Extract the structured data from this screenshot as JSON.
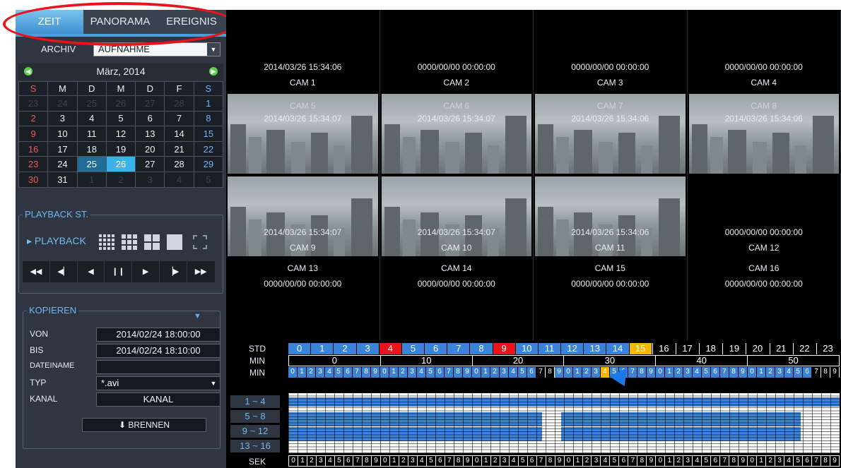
{
  "tabs": [
    {
      "label": "ZEIT",
      "active": true
    },
    {
      "label": "PANORAMA",
      "active": false
    },
    {
      "label": "EREIGNIS",
      "active": false
    }
  ],
  "archive": {
    "label": "ARCHIV",
    "selected": "AUFNAHME"
  },
  "calendar": {
    "title": "März‚ 2014",
    "weekdays": [
      "S",
      "M",
      "D",
      "M",
      "D",
      "F",
      "S"
    ],
    "weeks": [
      [
        "23",
        "24",
        "25",
        "26",
        "27",
        "28",
        "1"
      ],
      [
        "2",
        "3",
        "4",
        "5",
        "6",
        "7",
        "8"
      ],
      [
        "9",
        "10",
        "11",
        "12",
        "13",
        "14",
        "15"
      ],
      [
        "16",
        "17",
        "18",
        "19",
        "20",
        "21",
        "22"
      ],
      [
        "23",
        "24",
        "25",
        "26",
        "27",
        "28",
        "29"
      ],
      [
        "30",
        "31",
        "1",
        "2",
        "3",
        "4",
        "5"
      ]
    ],
    "recorded_day": "25",
    "selected_day": "26"
  },
  "playback": {
    "group_title": "PLAYBACK ST.",
    "label": "PLAYBACK",
    "controls": [
      "◀◀",
      "◀▏",
      "◀",
      "❙❙",
      "▶",
      "▕▶",
      "▶▶"
    ]
  },
  "copy": {
    "group_title": "KOPIEREN",
    "von_label": "VON",
    "von_value": "2014/02/24 18:00:00",
    "bis_label": "BIS",
    "bis_value": "2014/02/24 18:10:00",
    "dateiname_label": "DATEINAME",
    "dateiname_value": "",
    "typ_label": "TYP",
    "typ_value": "*.avi",
    "kanal_label": "KANAL",
    "kanal_button": "KANAL",
    "burn_button": "BRENNEN"
  },
  "cameras": [
    {
      "name": "CAM 1",
      "time": "2014/03/26 15:34:06",
      "video": false
    },
    {
      "name": "CAM 2",
      "time": "0000/00/00 00:00:00",
      "video": false
    },
    {
      "name": "CAM 3",
      "time": "0000/00/00 00:00:00",
      "video": false
    },
    {
      "name": "CAM 4",
      "time": "0000/00/00 00:00:00",
      "video": false
    },
    {
      "name": "CAM 5",
      "time": "2014/03/26 15:34:07",
      "video": true
    },
    {
      "name": "CAM 6",
      "time": "2014/03/26 15:34:07",
      "video": true
    },
    {
      "name": "CAM 7",
      "time": "2014/03/26 15:34:06",
      "video": true
    },
    {
      "name": "CAM 8",
      "time": "2014/03/26 15:34:06",
      "video": true
    },
    {
      "name": "CAM 9",
      "time": "2014/03/26 15:34:07",
      "video": true
    },
    {
      "name": "CAM 10",
      "time": "2014/03/26 15:34:07",
      "video": true
    },
    {
      "name": "CAM 11",
      "time": "2014/03/26 15:34:06",
      "video": true
    },
    {
      "name": "CAM 12",
      "time": "0000/00/00 00:00:00",
      "video": false
    },
    {
      "name": "CAM 13",
      "time": "0000/00/00 00:00:00",
      "video": false
    },
    {
      "name": "CAM 14",
      "time": "0000/00/00 00:00:00",
      "video": false
    },
    {
      "name": "CAM 15",
      "time": "0000/00/00 00:00:00",
      "video": false
    },
    {
      "name": "CAM 16",
      "time": "0000/00/00 00:00:00",
      "video": false
    }
  ],
  "timeline": {
    "std_label": "STD",
    "min_label": "MIN",
    "min1_label": "MIN",
    "sek_label": "SEK",
    "hours": [
      "0",
      "1",
      "2",
      "3",
      "4",
      "5",
      "6",
      "7",
      "8",
      "9",
      "10",
      "11",
      "12",
      "13",
      "14",
      "15",
      "16",
      "17",
      "18",
      "19",
      "20",
      "21",
      "22",
      "23"
    ],
    "red_hours": [
      "4",
      "9"
    ],
    "yellow_hours": [
      "15"
    ],
    "black_hours": [
      "16",
      "17",
      "18",
      "19",
      "20",
      "21",
      "22",
      "23"
    ],
    "minute_tens": [
      "0",
      "10",
      "20",
      "30",
      "40",
      "50"
    ],
    "minute_ones": [
      "0",
      "1",
      "2",
      "3",
      "4",
      "5",
      "6",
      "7",
      "8",
      "9"
    ],
    "channels": [
      "1 ~ 4",
      "5 ~ 8",
      "9 ~ 12",
      "13 ~ 16"
    ],
    "recorded_minute": "34",
    "colors": {
      "blue": "#3a83d6",
      "red": "#e8141c",
      "yellow": "#f2b700"
    }
  }
}
